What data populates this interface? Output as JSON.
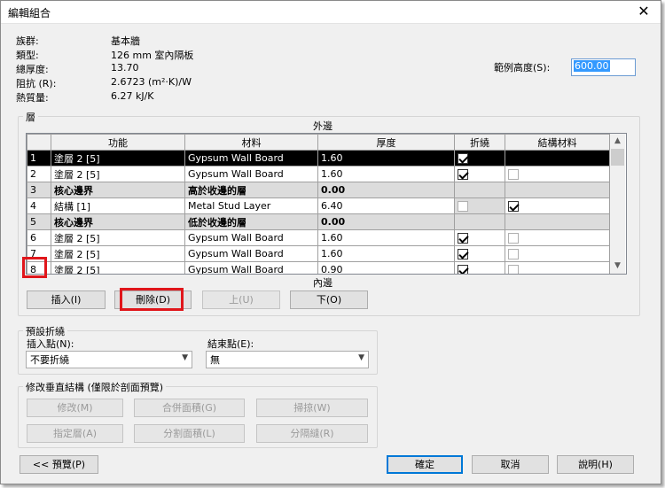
{
  "window": {
    "title": "編輯組合",
    "close_glyph": "✕"
  },
  "info": [
    {
      "label": "族群:",
      "value": "基本牆"
    },
    {
      "label": "類型:",
      "value": "126 mm 室內隔板"
    },
    {
      "label": "總厚度:",
      "value": "13.70"
    },
    {
      "label": "阻抗 (R):",
      "value": "2.6723 (m²·K)/W"
    },
    {
      "label": "熱質量:",
      "value": "6.27 kJ/K"
    }
  ],
  "sample_height": {
    "label": "範例高度(S):",
    "value": "600.00"
  },
  "layers": {
    "group_title": "層",
    "exterior_label": "外邊",
    "interior_label": "內邊",
    "headers": [
      "功能",
      "材料",
      "厚度",
      "折繞",
      "結構材料"
    ],
    "rows": [
      {
        "num": "1",
        "func": "塗層 2 [5]",
        "material": "Gypsum Wall Board",
        "thickness": "1.60",
        "wrap": true,
        "structural": false
      },
      {
        "num": "2",
        "func": "塗層 2 [5]",
        "material": "Gypsum Wall Board",
        "thickness": "1.60",
        "wrap": true,
        "structural": false
      },
      {
        "num": "3",
        "func": "核心邊界",
        "material": "高於收邊的層",
        "thickness": "0.00"
      },
      {
        "num": "4",
        "func": "結構 [1]",
        "material": "Metal Stud Layer",
        "thickness": "6.40",
        "wrap": false,
        "structural": true
      },
      {
        "num": "5",
        "func": "核心邊界",
        "material": "低於收邊的層",
        "thickness": "0.00"
      },
      {
        "num": "6",
        "func": "塗層 2 [5]",
        "material": "Gypsum Wall Board",
        "thickness": "1.60",
        "wrap": true,
        "structural": false
      },
      {
        "num": "7",
        "func": "塗層 2 [5]",
        "material": "Gypsum Wall Board",
        "thickness": "1.60",
        "wrap": true,
        "structural": false
      },
      {
        "num": "8",
        "func": "塗層 2 [5]",
        "material": "Gypsum Wall Board",
        "thickness": "0.90",
        "wrap": true,
        "structural": false
      }
    ],
    "buttons": {
      "insert": "插入(I)",
      "delete": "刪除(D)",
      "up": "上(U)",
      "down": "下(O)"
    }
  },
  "default_wrapping": {
    "group_title": "預設折繞",
    "insert_label": "插入點(N):",
    "insert_value": "不要折繞",
    "end_label": "結束點(E):",
    "end_value": "無"
  },
  "modify_structure": {
    "group_title": "修改垂直結構 (僅限於剖面預覽)",
    "buttons": [
      "修改(M)",
      "合併面積(G)",
      "掃掠(W)",
      "指定層(A)",
      "分割面積(L)",
      "分隔縫(R)"
    ]
  },
  "footer": {
    "preview": "<< 預覽(P)",
    "ok": "確定",
    "cancel": "取消",
    "help": "說明(H)"
  },
  "colors": {
    "highlight": "#e0161b",
    "selection": "#3399ff",
    "default_border": "#0078d7"
  }
}
